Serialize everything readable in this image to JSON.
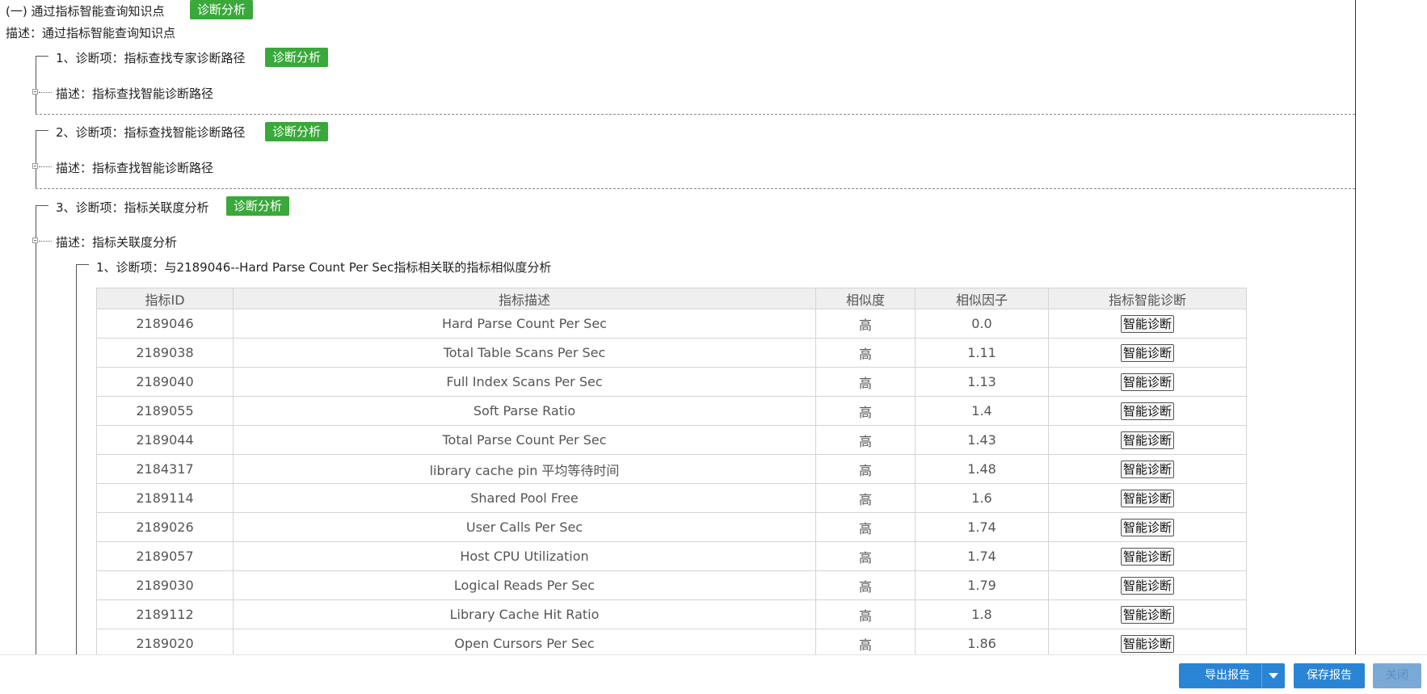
{
  "section": {
    "title": "(一)  通过指标智能查询知识点",
    "button": "诊断分析",
    "desc": "描述：通过指标智能查询知识点"
  },
  "items": [
    {
      "title": "1、诊断项：指标查找专家诊断路径",
      "button": "诊断分析",
      "desc": "描述：指标查找智能诊断路径"
    },
    {
      "title": "2、诊断项：指标查找智能诊断路径",
      "button": "诊断分析",
      "desc": "描述：指标查找智能诊断路径"
    },
    {
      "title": "3、诊断项：指标关联度分析",
      "button": "诊断分析",
      "desc": "描述：指标关联度分析"
    }
  ],
  "sub_item": {
    "title": "1、诊断项：与2189046--Hard Parse Count Per Sec指标相关联的指标相似度分析"
  },
  "table": {
    "headers": [
      "指标ID",
      "指标描述",
      "相似度",
      "相似因子",
      "指标智能诊断"
    ],
    "action_label": "智能诊断",
    "rows": [
      {
        "id": "2189046",
        "desc": "Hard Parse Count Per Sec",
        "sim": "高",
        "factor": "0.0"
      },
      {
        "id": "2189038",
        "desc": "Total Table Scans Per Sec",
        "sim": "高",
        "factor": "1.11"
      },
      {
        "id": "2189040",
        "desc": "Full Index Scans Per Sec",
        "sim": "高",
        "factor": "1.13"
      },
      {
        "id": "2189055",
        "desc": "Soft Parse Ratio",
        "sim": "高",
        "factor": "1.4"
      },
      {
        "id": "2189044",
        "desc": "Total Parse Count Per Sec",
        "sim": "高",
        "factor": "1.43"
      },
      {
        "id": "2184317",
        "desc": "library cache pin 平均等待时间",
        "sim": "高",
        "factor": "1.48"
      },
      {
        "id": "2189114",
        "desc": "Shared Pool Free",
        "sim": "高",
        "factor": "1.6"
      },
      {
        "id": "2189026",
        "desc": "User Calls Per Sec",
        "sim": "高",
        "factor": "1.74"
      },
      {
        "id": "2189057",
        "desc": "Host CPU Utilization",
        "sim": "高",
        "factor": "1.74"
      },
      {
        "id": "2189030",
        "desc": "Logical Reads Per Sec",
        "sim": "高",
        "factor": "1.79"
      },
      {
        "id": "2189112",
        "desc": "Library Cache Hit Ratio",
        "sim": "高",
        "factor": "1.8"
      },
      {
        "id": "2189020",
        "desc": "Open Cursors Per Sec",
        "sim": "高",
        "factor": "1.86"
      }
    ]
  },
  "footer": {
    "export_label": "导出报告",
    "save_label": "保存报告",
    "close_label": "关闭"
  },
  "colors": {
    "green": "#3aa83a",
    "blue": "#2a84d6",
    "disabled": "#7aa9d6"
  }
}
